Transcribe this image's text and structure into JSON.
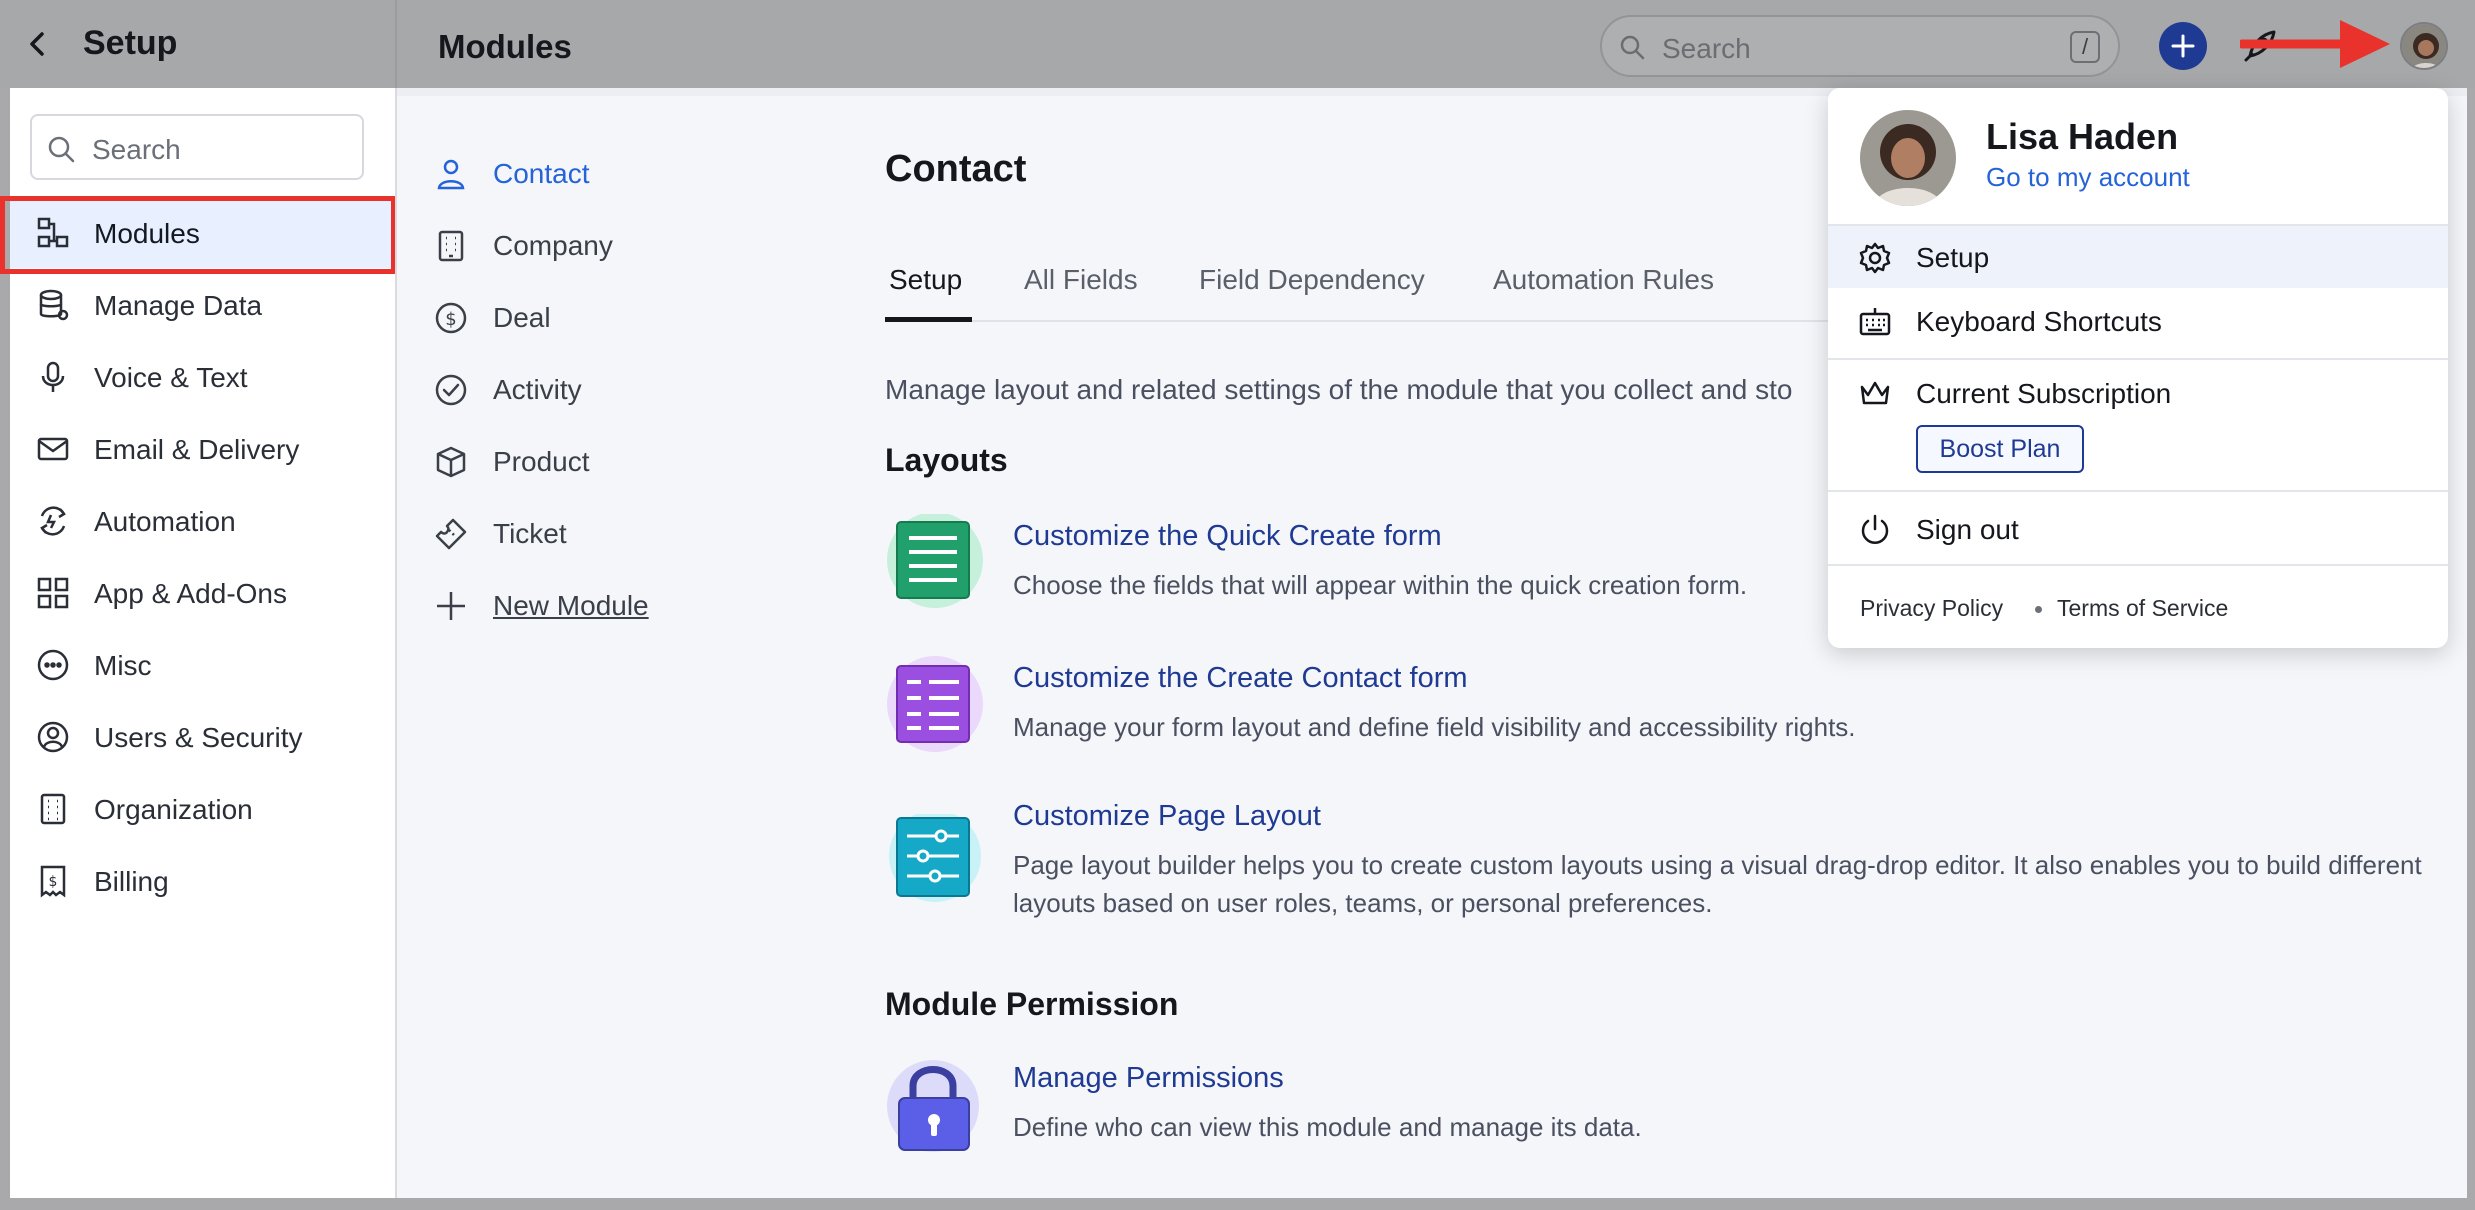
{
  "topbar": {
    "setup_title": "Setup",
    "page_title": "Modules",
    "search_placeholder": "Search",
    "search_shortcut": "/"
  },
  "sidebar": {
    "search_placeholder": "Search",
    "items": [
      {
        "label": "Modules",
        "icon": "modules-icon",
        "active": true
      },
      {
        "label": "Manage Data",
        "icon": "database-icon"
      },
      {
        "label": "Voice & Text",
        "icon": "microphone-icon"
      },
      {
        "label": "Email & Delivery",
        "icon": "mail-icon"
      },
      {
        "label": "Automation",
        "icon": "automation-icon"
      },
      {
        "label": "App & Add-Ons",
        "icon": "apps-grid-icon"
      },
      {
        "label": "Misc",
        "icon": "more-circle-icon"
      },
      {
        "label": "Users & Security",
        "icon": "user-circle-icon"
      },
      {
        "label": "Organization",
        "icon": "building-icon"
      },
      {
        "label": "Billing",
        "icon": "invoice-icon"
      }
    ]
  },
  "modules": {
    "items": [
      {
        "label": "Contact",
        "icon": "person-icon",
        "active": true
      },
      {
        "label": "Company",
        "icon": "building-icon"
      },
      {
        "label": "Deal",
        "icon": "dollar-circle-icon"
      },
      {
        "label": "Activity",
        "icon": "check-circle-icon"
      },
      {
        "label": "Product",
        "icon": "box-icon"
      },
      {
        "label": "Ticket",
        "icon": "ticket-icon"
      }
    ],
    "new_module": "New Module"
  },
  "content": {
    "title": "Contact",
    "tabs": [
      "Setup",
      "All Fields",
      "Field Dependency",
      "Automation Rules"
    ],
    "description": "Manage layout and related settings of the module that you collect and sto",
    "layouts_title": "Layouts",
    "features": [
      {
        "title": "Customize the Quick Create form",
        "desc": "Choose the fields that will appear within the quick creation form.",
        "icon": "quick-form-icon"
      },
      {
        "title": "Customize the Create Contact form",
        "desc": "Manage your form layout and define field visibility and accessibility rights.",
        "icon": "contact-form-icon"
      },
      {
        "title": "Customize Page Layout",
        "desc": "Page layout builder helps you to create custom layouts using a visual drag-drop editor. It also enables you to build different layouts based on user roles, teams, or personal preferences.",
        "icon": "page-layout-icon"
      }
    ],
    "permission_title": "Module Permission",
    "permission": {
      "title": "Manage Permissions",
      "desc": "Define who can view this module and manage its data.",
      "icon": "lock-icon"
    }
  },
  "menu": {
    "user_name": "Lisa Haden",
    "account_link": "Go to my account",
    "items": [
      {
        "label": "Setup",
        "icon": "gear-icon"
      },
      {
        "label": "Keyboard Shortcuts",
        "icon": "keyboard-icon"
      },
      {
        "label": "Current Subscription",
        "icon": "crown-icon"
      },
      {
        "label": "Sign out",
        "icon": "power-icon"
      }
    ],
    "plan": "Boost Plan",
    "privacy": "Privacy Policy",
    "terms": "Terms of Service"
  },
  "colors": {
    "accent": "#2563d8",
    "link": "#1f3a93",
    "highlight_red": "#e8322b"
  }
}
